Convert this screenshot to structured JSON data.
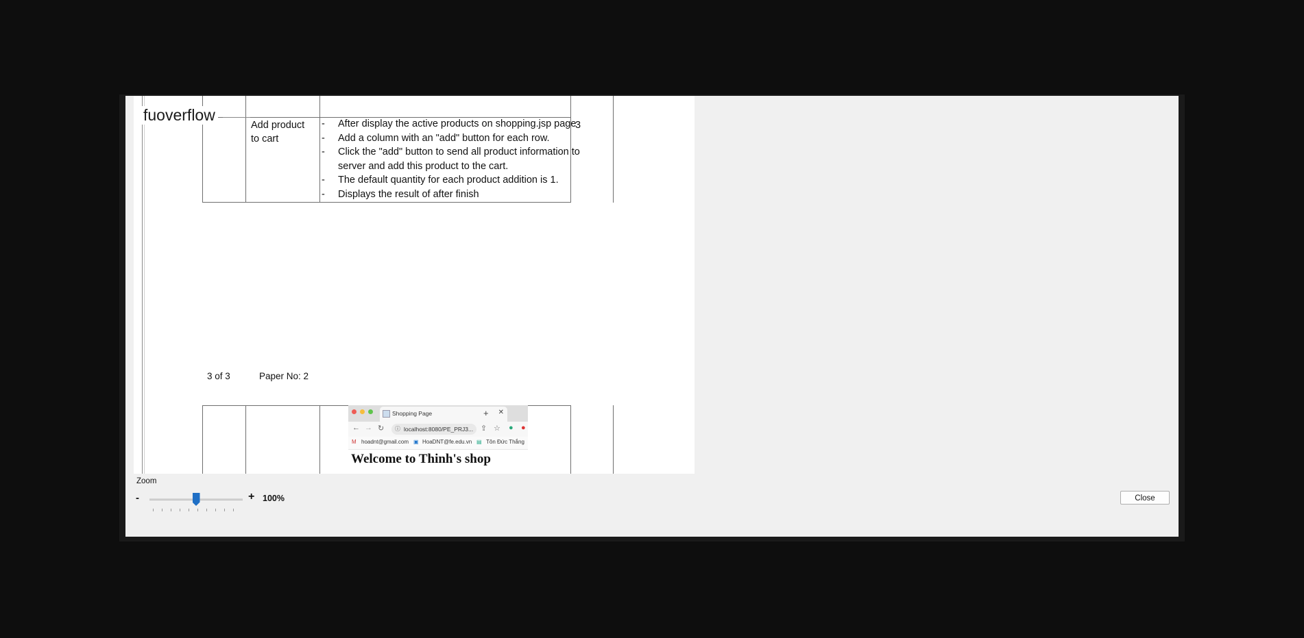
{
  "watermark": "fuoverflow",
  "document": {
    "row": {
      "feature": [
        "Add product",
        "to cart"
      ],
      "requirements": [
        "After display the active products on shopping.jsp page",
        "Add a column with an \"add\" button for each row.",
        "Click the \"add\" button to send all product information to server and add this product to the cart.",
        "The default quantity for each product addition is 1.",
        "Displays the result of after finish"
      ],
      "mark": "3"
    },
    "footer": {
      "page_info": "3 of 3",
      "paper_no": "Paper No: 2"
    },
    "embedded_screenshot": {
      "tab_title": "Shopping Page",
      "url": "localhost:8080/PE_PRJ3...",
      "bookmarks": [
        "hoadnt@gmail.com",
        "HoaDNT@fe.edu.vn",
        "Tôn Đức Thắng"
      ],
      "heading": "Welcome to Thinh's shop"
    }
  },
  "zoom": {
    "label": "Zoom",
    "minus": "-",
    "plus": "+",
    "value": "100%",
    "level_fraction": 0.5
  },
  "close_label": "Close"
}
